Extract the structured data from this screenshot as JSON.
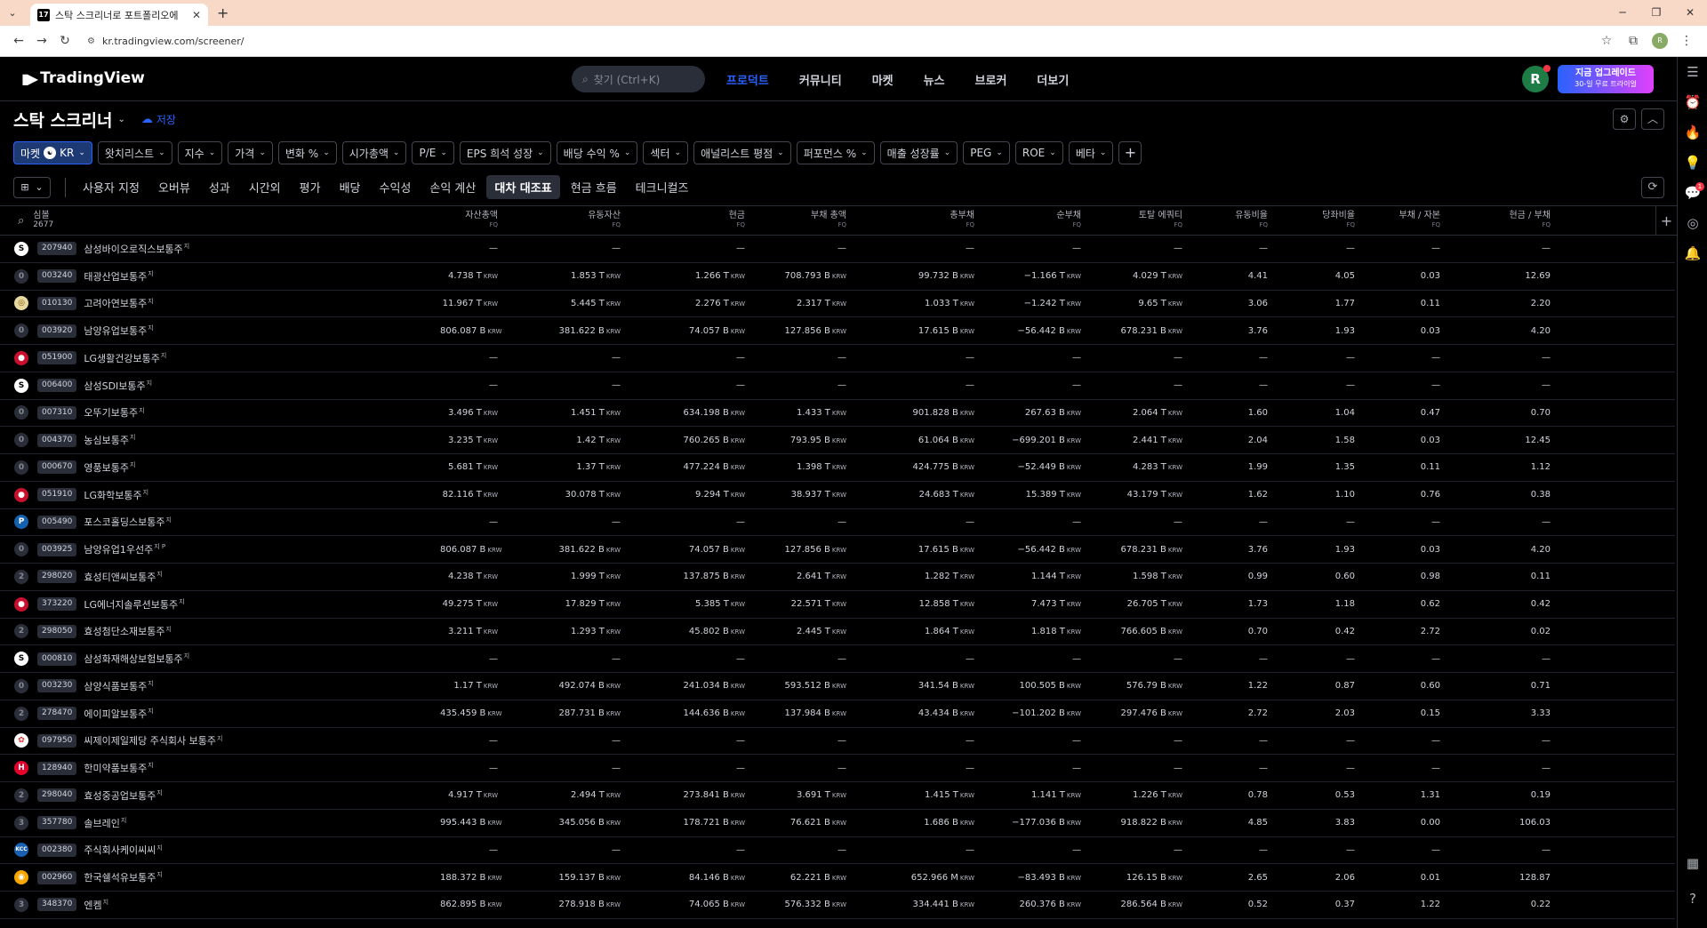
{
  "browser": {
    "tab_title": "스탁 스크리너로 포트폴리오에",
    "tab_favicon": "17",
    "url": "kr.tradingview.com/screener/",
    "profile_initial": "R"
  },
  "nav": {
    "logo": "TradingView",
    "search_placeholder": "찾기 (Ctrl+K)",
    "links": [
      "프로덕트",
      "커뮤니티",
      "마켓",
      "뉴스",
      "브로커",
      "더보기"
    ],
    "avatar": "R",
    "upgrade_title": "지금 업그레이드",
    "upgrade_sub": "30-일 무료 트라이얼"
  },
  "page": {
    "title": "스탁 스크리너",
    "save_label": "저장"
  },
  "filters": {
    "market_label": "마켓",
    "market_value": "KR",
    "chips": [
      "왓치리스트",
      "지수",
      "가격",
      "변화 %",
      "시가총액",
      "P/E",
      "EPS 희석 성장",
      "배당 수익 %",
      "섹터",
      "애널리스트 평점",
      "퍼포먼스 %",
      "매출 성장률",
      "PEG",
      "ROE",
      "베타"
    ]
  },
  "tabs": {
    "items": [
      "사용자 지정",
      "오버뷰",
      "성과",
      "시간외",
      "평가",
      "배당",
      "수익성",
      "손익 계산",
      "대차 대조표",
      "현금 흐름",
      "테크니컬즈"
    ],
    "active": "대차 대조표"
  },
  "table": {
    "symbol_header": "심볼",
    "symbol_count": "2677",
    "period_label": "FQ",
    "columns": [
      "자산총액",
      "유동자산",
      "현금",
      "부채 총액",
      "총부채",
      "순부채",
      "토탈 에쿼티",
      "유동비율",
      "당좌비율",
      "부채 / 자본",
      "현금 / 부채"
    ],
    "rows": [
      {
        "logo": "S",
        "color": "#ffffff",
        "fg": "#000000",
        "ticker": "207940",
        "name": "삼성바이오로직스보통주",
        "sup": "지",
        "v": [
          "—",
          "—",
          "—",
          "—",
          "—",
          "—",
          "—",
          "—",
          "—",
          "—",
          "—"
        ]
      },
      {
        "logo": "0",
        "color": "#2a2e39",
        "fg": "#868993",
        "ticker": "003240",
        "name": "태광산업보통주",
        "sup": "지",
        "v": [
          "4.738 T|KRW",
          "1.853 T|KRW",
          "1.266 T|KRW",
          "708.793 B|KRW",
          "99.732 B|KRW",
          "−1.166 T|KRW",
          "4.029 T|KRW",
          "4.41",
          "4.05",
          "0.03",
          "12.69"
        ]
      },
      {
        "logo": "◎",
        "color": "#e8d9a0",
        "fg": "#7a5a00",
        "ticker": "010130",
        "name": "고려아연보통주",
        "sup": "지",
        "v": [
          "11.967 T|KRW",
          "5.445 T|KRW",
          "2.276 T|KRW",
          "2.317 T|KRW",
          "1.033 T|KRW",
          "−1.242 T|KRW",
          "9.65 T|KRW",
          "3.06",
          "1.77",
          "0.11",
          "2.20"
        ]
      },
      {
        "logo": "0",
        "color": "#2a2e39",
        "fg": "#868993",
        "ticker": "003920",
        "name": "남양유업보통주",
        "sup": "지",
        "v": [
          "806.087 B|KRW",
          "381.622 B|KRW",
          "74.057 B|KRW",
          "127.856 B|KRW",
          "17.615 B|KRW",
          "−56.442 B|KRW",
          "678.231 B|KRW",
          "3.76",
          "1.93",
          "0.03",
          "4.20"
        ]
      },
      {
        "logo": "●",
        "color": "#c8102e",
        "fg": "#ffffff",
        "ticker": "051900",
        "name": "LG생활건강보통주",
        "sup": "지",
        "v": [
          "—",
          "—",
          "—",
          "—",
          "—",
          "—",
          "—",
          "—",
          "—",
          "—",
          "—"
        ]
      },
      {
        "logo": "S",
        "color": "#ffffff",
        "fg": "#000000",
        "ticker": "006400",
        "name": "삼성SDI보통주",
        "sup": "지",
        "v": [
          "—",
          "—",
          "—",
          "—",
          "—",
          "—",
          "—",
          "—",
          "—",
          "—",
          "—"
        ]
      },
      {
        "logo": "0",
        "color": "#2a2e39",
        "fg": "#868993",
        "ticker": "007310",
        "name": "오뚜기보통주",
        "sup": "지",
        "v": [
          "3.496 T|KRW",
          "1.451 T|KRW",
          "634.198 B|KRW",
          "1.433 T|KRW",
          "901.828 B|KRW",
          "267.63 B|KRW",
          "2.064 T|KRW",
          "1.60",
          "1.04",
          "0.47",
          "0.70"
        ]
      },
      {
        "logo": "0",
        "color": "#2a2e39",
        "fg": "#868993",
        "ticker": "004370",
        "name": "농심보통주",
        "sup": "지",
        "v": [
          "3.235 T|KRW",
          "1.42 T|KRW",
          "760.265 B|KRW",
          "793.95 B|KRW",
          "61.064 B|KRW",
          "−699.201 B|KRW",
          "2.441 T|KRW",
          "2.04",
          "1.58",
          "0.03",
          "12.45"
        ]
      },
      {
        "logo": "0",
        "color": "#2a2e39",
        "fg": "#868993",
        "ticker": "000670",
        "name": "영풍보통주",
        "sup": "지",
        "v": [
          "5.681 T|KRW",
          "1.37 T|KRW",
          "477.224 B|KRW",
          "1.398 T|KRW",
          "424.775 B|KRW",
          "−52.449 B|KRW",
          "4.283 T|KRW",
          "1.99",
          "1.35",
          "0.11",
          "1.12"
        ]
      },
      {
        "logo": "●",
        "color": "#c8102e",
        "fg": "#ffffff",
        "ticker": "051910",
        "name": "LG화학보통주",
        "sup": "지",
        "v": [
          "82.116 T|KRW",
          "30.078 T|KRW",
          "9.294 T|KRW",
          "38.937 T|KRW",
          "24.683 T|KRW",
          "15.389 T|KRW",
          "43.179 T|KRW",
          "1.62",
          "1.10",
          "0.76",
          "0.38"
        ]
      },
      {
        "logo": "P",
        "color": "#1561ad",
        "fg": "#ffffff",
        "ticker": "005490",
        "name": "포스코홀딩스보통주",
        "sup": "지",
        "v": [
          "—",
          "—",
          "—",
          "—",
          "—",
          "—",
          "—",
          "—",
          "—",
          "—",
          "—"
        ]
      },
      {
        "logo": "0",
        "color": "#2a2e39",
        "fg": "#868993",
        "ticker": "003925",
        "name": "남양유업1우선주",
        "sup": "지 P",
        "v": [
          "806.087 B|KRW",
          "381.622 B|KRW",
          "74.057 B|KRW",
          "127.856 B|KRW",
          "17.615 B|KRW",
          "−56.442 B|KRW",
          "678.231 B|KRW",
          "3.76",
          "1.93",
          "0.03",
          "4.20"
        ]
      },
      {
        "logo": "2",
        "color": "#2a2e39",
        "fg": "#868993",
        "ticker": "298020",
        "name": "효성티앤씨보통주",
        "sup": "지",
        "v": [
          "4.238 T|KRW",
          "1.999 T|KRW",
          "137.875 B|KRW",
          "2.641 T|KRW",
          "1.282 T|KRW",
          "1.144 T|KRW",
          "1.598 T|KRW",
          "0.99",
          "0.60",
          "0.98",
          "0.11"
        ]
      },
      {
        "logo": "●",
        "color": "#c8102e",
        "fg": "#ffffff",
        "ticker": "373220",
        "name": "LG에너지솔루션보통주",
        "sup": "지",
        "v": [
          "49.275 T|KRW",
          "17.829 T|KRW",
          "5.385 T|KRW",
          "22.571 T|KRW",
          "12.858 T|KRW",
          "7.473 T|KRW",
          "26.705 T|KRW",
          "1.73",
          "1.18",
          "0.62",
          "0.42"
        ]
      },
      {
        "logo": "2",
        "color": "#2a2e39",
        "fg": "#868993",
        "ticker": "298050",
        "name": "효성첨단소재보통주",
        "sup": "지",
        "v": [
          "3.211 T|KRW",
          "1.293 T|KRW",
          "45.802 B|KRW",
          "2.445 T|KRW",
          "1.864 T|KRW",
          "1.818 T|KRW",
          "766.605 B|KRW",
          "0.70",
          "0.42",
          "2.72",
          "0.02"
        ]
      },
      {
        "logo": "S",
        "color": "#ffffff",
        "fg": "#000000",
        "ticker": "000810",
        "name": "삼성화재해상보험보통주",
        "sup": "지",
        "v": [
          "—",
          "—",
          "—",
          "—",
          "—",
          "—",
          "—",
          "—",
          "—",
          "—",
          "—"
        ]
      },
      {
        "logo": "0",
        "color": "#2a2e39",
        "fg": "#868993",
        "ticker": "003230",
        "name": "삼양식품보통주",
        "sup": "지",
        "v": [
          "1.17 T|KRW",
          "492.074 B|KRW",
          "241.034 B|KRW",
          "593.512 B|KRW",
          "341.54 B|KRW",
          "100.505 B|KRW",
          "576.79 B|KRW",
          "1.22",
          "0.87",
          "0.60",
          "0.71"
        ]
      },
      {
        "logo": "2",
        "color": "#2a2e39",
        "fg": "#868993",
        "ticker": "278470",
        "name": "에이피알보통주",
        "sup": "지",
        "v": [
          "435.459 B|KRW",
          "287.731 B|KRW",
          "144.636 B|KRW",
          "137.984 B|KRW",
          "43.434 B|KRW",
          "−101.202 B|KRW",
          "297.476 B|KRW",
          "2.72",
          "2.03",
          "0.15",
          "3.33"
        ]
      },
      {
        "logo": "✿",
        "color": "#ffffff",
        "fg": "#e5322d",
        "ticker": "097950",
        "name": "씨제이제일제당 주식회사 보통주",
        "sup": "지",
        "v": [
          "—",
          "—",
          "—",
          "—",
          "—",
          "—",
          "—",
          "—",
          "—",
          "—",
          "—"
        ]
      },
      {
        "logo": "H",
        "color": "#e4002b",
        "fg": "#ffffff",
        "ticker": "128940",
        "name": "한미약품보통주",
        "sup": "지",
        "v": [
          "—",
          "—",
          "—",
          "—",
          "—",
          "—",
          "—",
          "—",
          "—",
          "—",
          "—"
        ]
      },
      {
        "logo": "2",
        "color": "#2a2e39",
        "fg": "#868993",
        "ticker": "298040",
        "name": "효성중공업보통주",
        "sup": "지",
        "v": [
          "4.917 T|KRW",
          "2.494 T|KRW",
          "273.841 B|KRW",
          "3.691 T|KRW",
          "1.415 T|KRW",
          "1.141 T|KRW",
          "1.226 T|KRW",
          "0.78",
          "0.53",
          "1.31",
          "0.19"
        ]
      },
      {
        "logo": "3",
        "color": "#2a2e39",
        "fg": "#868993",
        "ticker": "357780",
        "name": "솔브레인",
        "sup": "지",
        "v": [
          "995.443 B|KRW",
          "345.056 B|KRW",
          "178.721 B|KRW",
          "76.621 B|KRW",
          "1.686 B|KRW",
          "−177.036 B|KRW",
          "918.822 B|KRW",
          "4.85",
          "3.83",
          "0.00",
          "106.03"
        ]
      },
      {
        "logo": "KCC",
        "color": "#1b5fb0",
        "fg": "#ffffff",
        "ticker": "002380",
        "name": "주식회사케이씨씨",
        "sup": "지",
        "v": [
          "—",
          "—",
          "—",
          "—",
          "—",
          "—",
          "—",
          "—",
          "—",
          "—",
          "—"
        ]
      },
      {
        "logo": "◉",
        "color": "#f5a700",
        "fg": "#ffffff",
        "ticker": "002960",
        "name": "한국쉘석유보통주",
        "sup": "지",
        "v": [
          "188.372 B|KRW",
          "159.137 B|KRW",
          "84.146 B|KRW",
          "62.221 B|KRW",
          "652.966 M|KRW",
          "−83.493 B|KRW",
          "126.15 B|KRW",
          "2.65",
          "2.06",
          "0.01",
          "128.87"
        ]
      },
      {
        "logo": "3",
        "color": "#2a2e39",
        "fg": "#868993",
        "ticker": "348370",
        "name": "엔켐",
        "sup": "지",
        "v": [
          "862.895 B|KRW",
          "278.918 B|KRW",
          "74.065 B|KRW",
          "576.332 B|KRW",
          "334.441 B|KRW",
          "260.376 B|KRW",
          "286.564 B|KRW",
          "0.52",
          "0.37",
          "1.22",
          "0.22"
        ]
      }
    ]
  },
  "sidebar_badge": "1"
}
